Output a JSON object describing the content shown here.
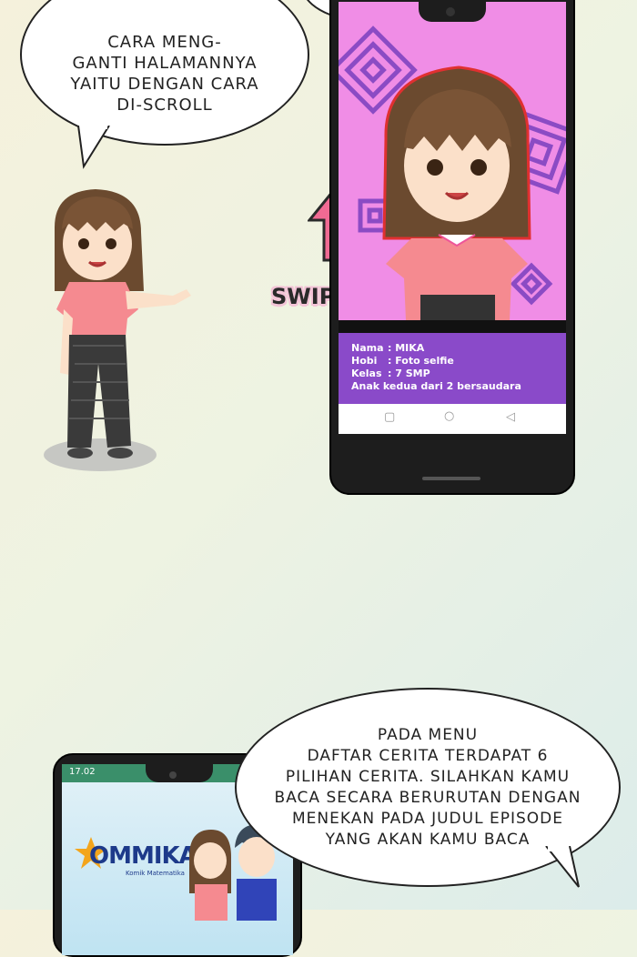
{
  "bubble_top": {
    "lines": [
      "CARA MENG-",
      "GANTI HALAMANNYA",
      "YAITU DENGAN CARA",
      "DI-SCROLL"
    ]
  },
  "swipe_label": "SWIPE UP",
  "phone_top": {
    "profile": [
      {
        "key": "Nama",
        "value": ": MIKA"
      },
      {
        "key": "Hobi",
        "value": ": Foto selfie"
      },
      {
        "key": "Kelas",
        "value": ": 7 SMP"
      }
    ],
    "profile_note": "Anak kedua dari 2 bersaudara",
    "nav": {
      "recent": "▢",
      "home": "○",
      "back": "◁"
    }
  },
  "bubble_bottom": {
    "lines": [
      "PADA MENU",
      "DAFTAR CERITA TERDAPAT 6",
      "PILIHAN CERITA. SILAHKAN KAMU",
      "BACA SECARA BERURUTAN DENGAN",
      "MENEKAN PADA JUDUL  EPISODE",
      "YANG AKAN KAMU BACA"
    ]
  },
  "phone_bottom": {
    "status_time": "17.02",
    "logo_text": "OMMIKA",
    "logo_subtitle": "Komik Matematika"
  },
  "colors": {
    "screen_pink": "#f08de6",
    "profile_purple": "#8a4ac9",
    "arrow_pink": "#f06a93",
    "logo_blue": "#1d3a8a",
    "logo_star": "#f3a51c"
  }
}
